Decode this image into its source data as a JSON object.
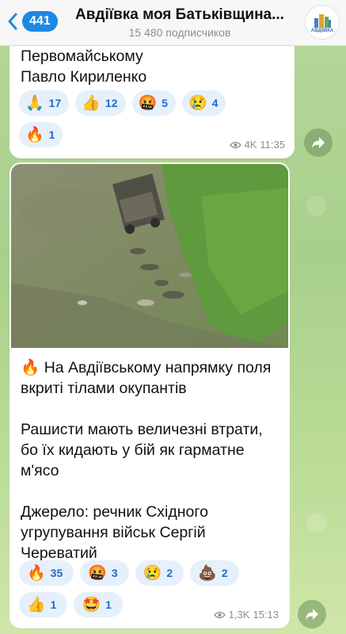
{
  "header": {
    "back_count": "441",
    "title": "Авдіївка моя Батьківщина...",
    "subtitle": "15 480 подписчиков",
    "avatar_text": "АВДІЇВКА"
  },
  "message1": {
    "text_line1": "Первомайському",
    "text_line2": "Павло Кириленко",
    "reactions": [
      {
        "emoji": "🙏",
        "count": "17"
      },
      {
        "emoji": "👍",
        "count": "12"
      },
      {
        "emoji": "🤬",
        "count": "5"
      },
      {
        "emoji": "😢",
        "count": "4"
      },
      {
        "emoji": "🔥",
        "count": "1"
      }
    ],
    "views": "4K",
    "time": "11:35"
  },
  "message2": {
    "para1": "🔥 На Авдіївському напрямку поля вкриті тілами окупантів",
    "para2": "Рашисти мають величезні втрати, бо їх кидають у бій як гарматне м'ясо",
    "para3": "Джерело: речник Східного угрупування військ Сергій Череватий",
    "reactions": [
      {
        "emoji": "🔥",
        "count": "35"
      },
      {
        "emoji": "🤬",
        "count": "3"
      },
      {
        "emoji": "😢",
        "count": "2"
      },
      {
        "emoji": "💩",
        "count": "2"
      },
      {
        "emoji": "👍",
        "count": "1"
      },
      {
        "emoji": "🤩",
        "count": "1"
      }
    ],
    "views": "1,3K",
    "time": "15:13"
  },
  "colors": {
    "accent": "#1e88e5",
    "reaction_bg": "#e6f0fb",
    "reaction_text": "#1e6cc8",
    "chat_bg": "#b6d79a"
  }
}
